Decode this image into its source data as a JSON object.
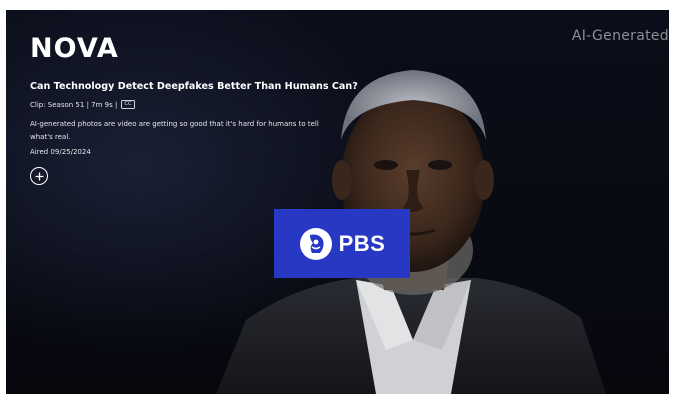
{
  "video": {
    "brand": "NOVA",
    "title": "Can Technology Detect Deepfakes Better Than Humans Can?",
    "meta": "Clip: Season 51 | 7m 9s |",
    "cc_label": "CC",
    "description": "AI-generated photos are video are getting so good that it's hard for humans to tell what's real.",
    "aired": "Aired 09/25/2024",
    "watermark": "AI-Generated",
    "broadcaster": "PBS"
  },
  "colors": {
    "background": "#090b14",
    "pbs_blue": "#2638c4",
    "text": "#ffffff",
    "watermark": "#8a8f99"
  },
  "icons": {
    "add": "plus-circle-icon",
    "pbs": "pbs-head-logo-icon"
  }
}
